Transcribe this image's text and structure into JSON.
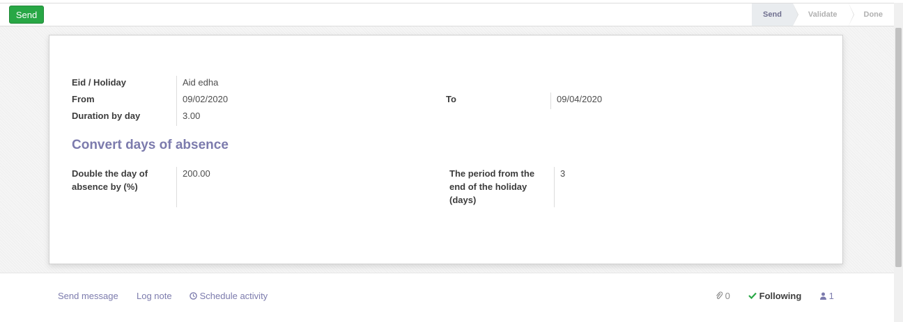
{
  "toolbar": {
    "send_label": "Send"
  },
  "stages": [
    {
      "label": "Send",
      "active": true
    },
    {
      "label": "Validate",
      "active": false
    },
    {
      "label": "Done",
      "active": false
    }
  ],
  "form": {
    "eid_label": "Eid / Holiday",
    "eid_value": "Aid edha",
    "from_label": "From",
    "from_value": "09/02/2020",
    "to_label": "To",
    "to_value": "09/04/2020",
    "duration_label": "Duration by day",
    "duration_value": "3.00",
    "section_title": "Convert days of absence",
    "double_label_1": "Double the day of",
    "double_label_2": "absence by (%)",
    "double_value": "200.00",
    "period_label_1": "The period from the",
    "period_label_2": "end of the holiday",
    "period_label_3": "(days)",
    "period_value": "3"
  },
  "chatter": {
    "send_message": "Send message",
    "log_note": "Log note",
    "schedule_activity": "Schedule activity",
    "attachments_count": "0",
    "following_label": "Following",
    "followers_count": "1"
  },
  "colors": {
    "accent": "#7c7bad",
    "send_button": "#28a745",
    "following_check": "#28a745"
  }
}
